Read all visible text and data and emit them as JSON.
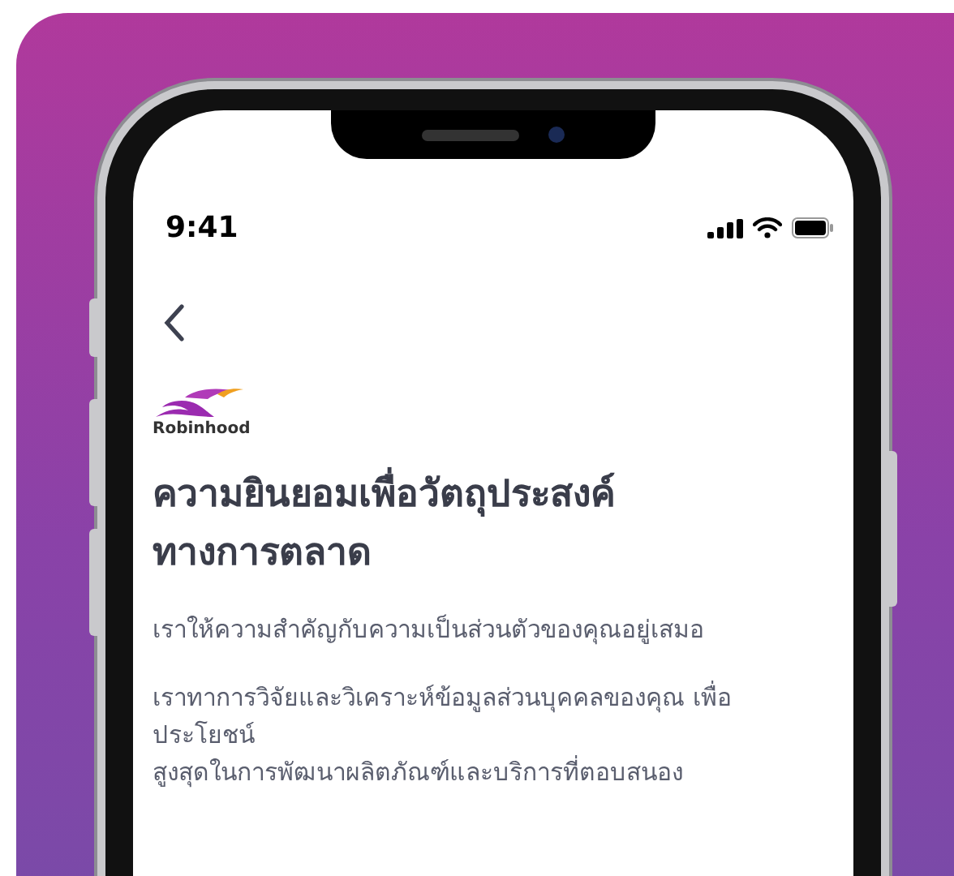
{
  "status_bar": {
    "time": "9:41"
  },
  "brand": {
    "name": "Robinhood"
  },
  "title": "ความยินยอมเพื่อวัตถุประสงค์\nทางการตลาด",
  "paragraphs": [
    "เราให้ความสำคัญกับความเป็นส่วนตัวของคุณอยู่เสมอ",
    "เราทาการวิจัยและวิเคราะห์ข้อมูลส่วนบุคคลของคุณ เพื่อ\nประโยชน์\nสูงสุดในการพัฒนาผลิตภัณฑ์และบริการที่ตอบสนอง"
  ]
}
